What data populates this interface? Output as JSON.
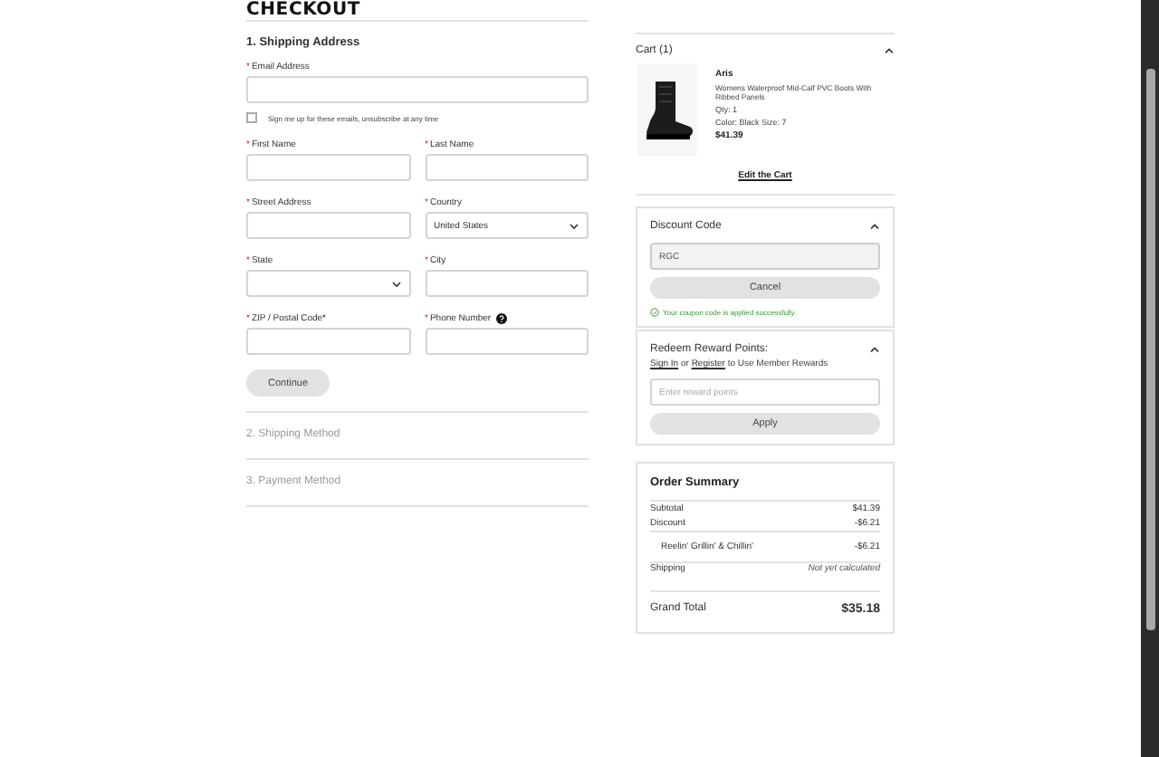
{
  "heading": "CHECKOUT",
  "shipping": {
    "title": "1. Shipping Address",
    "fields": [
      {
        "mark": "*",
        "label": "Email Address",
        "kind": "email",
        "help": false
      },
      {
        "mark": "*",
        "label": "First Name",
        "kind": "text",
        "help": false
      },
      {
        "mark": "*",
        "label": "Last Name",
        "kind": "text",
        "help": false
      },
      {
        "mark": "*",
        "label": "Street Address",
        "kind": "text",
        "help": false
      },
      {
        "mark": "*",
        "label": "Country",
        "kind": "select",
        "value": "United States",
        "help": false
      },
      {
        "mark": "*",
        "label": "State",
        "kind": "select",
        "help": false
      },
      {
        "mark": "*",
        "label": "City",
        "kind": "text",
        "help": false
      },
      {
        "mark": "*",
        "label": "ZIP / Postal Code*",
        "kind": "text",
        "help": false
      },
      {
        "mark": "*",
        "label": "Phone Number",
        "kind": "text",
        "help": true
      }
    ],
    "optin": {
      "label": "Sign me up for these emails, unsubscribe at any time",
      "checked": false
    },
    "button": "Continue"
  },
  "steps": [
    "2. Shipping Method",
    "3. Payment Method"
  ],
  "cart": {
    "title": "Cart (1)",
    "expanded": true,
    "item": {
      "brand": "Aris",
      "name": "Womens Waterproof Mid-Calf PVC Boots With Ribbed Panels",
      "qty": "Qty: 1",
      "variant": "Color: Black  Size: 7",
      "price": "$41.39"
    },
    "edit": "Edit the Cart"
  },
  "discount": {
    "title": "Discount Code",
    "expanded": true,
    "value": "RGC",
    "button": "Cancel",
    "message": "Your coupon code is applied successfully."
  },
  "rewards": {
    "title": "Redeem Reward Points:",
    "expanded": true,
    "note": [
      {
        "kind": "link",
        "text": "Sign In"
      },
      {
        "kind": "text",
        "text": " or "
      },
      {
        "kind": "link",
        "text": "Register"
      },
      {
        "kind": "text",
        "text": " to Use Member Rewards"
      }
    ],
    "placeholder": "Enter reward points",
    "button": "Apply"
  },
  "summary": {
    "title": "Order Summary",
    "rows": [
      {
        "kind": "line",
        "label": "Subtotal",
        "value": "$41.39"
      },
      {
        "kind": "line",
        "label": "Discount",
        "value": "-$6.21"
      },
      {
        "kind": "promo",
        "label": "Reelin' Grillin' & Chillin'",
        "value": "-$6.21"
      },
      {
        "kind": "note",
        "label": "Shipping",
        "value": "Not yet calculated"
      },
      {
        "kind": "total",
        "label": "Grand Total",
        "value": "$35.18"
      }
    ]
  }
}
